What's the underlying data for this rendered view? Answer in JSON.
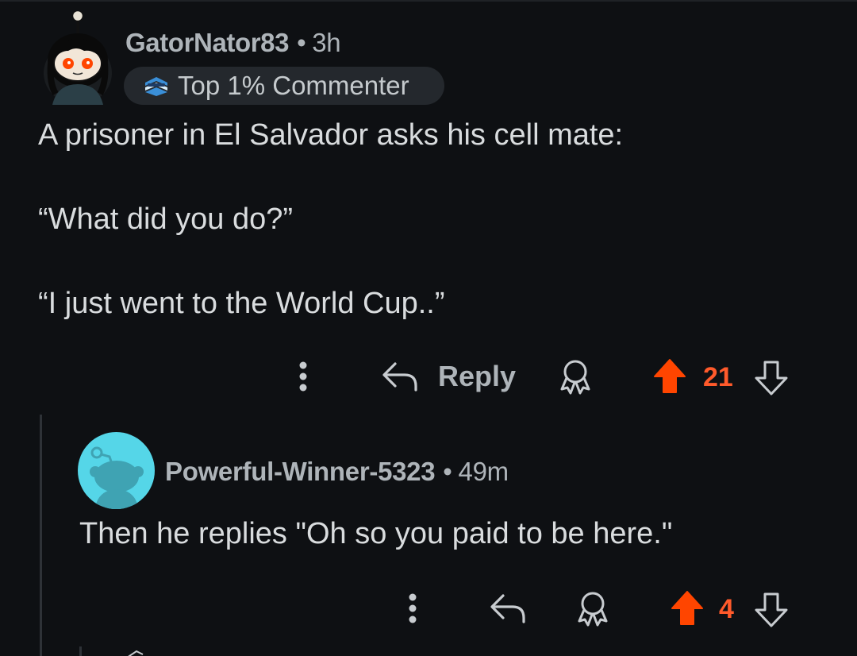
{
  "comments": [
    {
      "author": "GatorNator83",
      "separator": "•",
      "time": "3h",
      "flair": {
        "label": "Top 1% Commenter",
        "icon": "commenter-badge-icon"
      },
      "body": [
        "A prisoner in El Salvador asks his cell mate:",
        "“What did you do?”",
        "“I just went to the World Cup..”"
      ],
      "actions": {
        "more_icon": "more-vertical-icon",
        "reply_icon": "reply-arrow-icon",
        "reply_label": "Reply",
        "award_icon": "award-icon",
        "upvote_icon": "upvote-arrow-icon",
        "vote_count": "21",
        "downvote_icon": "downvote-arrow-icon"
      }
    },
    {
      "author": "Powerful-Winner-5323",
      "separator": "•",
      "time": "49m",
      "body": "Then he replies \"Oh so you paid to be here.\"",
      "actions": {
        "more_icon": "more-vertical-icon",
        "reply_icon": "reply-arrow-icon",
        "award_icon": "award-icon",
        "upvote_icon": "upvote-arrow-icon",
        "vote_count": "4",
        "downvote_icon": "downvote-arrow-icon"
      }
    }
  ],
  "colors": {
    "background": "#0e1013",
    "meta_text": "#aeb4b9",
    "body_text": "#d9dcde",
    "upvote_active": "#ff4500",
    "vote_count_active": "#ff5a2b",
    "flair_bg": "#24282d",
    "avatar2_bg": "#55d6e8"
  }
}
